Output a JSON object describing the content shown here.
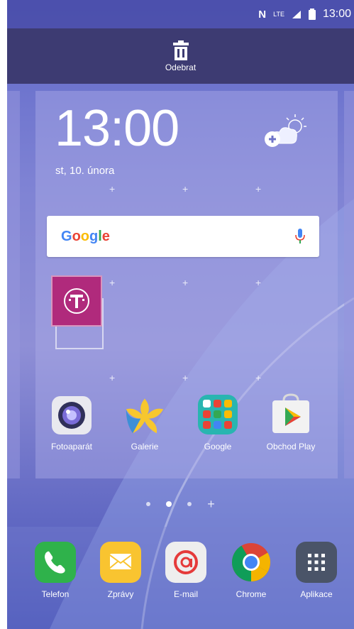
{
  "status_bar": {
    "time": "13:00",
    "network": "LTE",
    "nfc": "N"
  },
  "top_action": {
    "label": "Odebrat"
  },
  "widget": {
    "time": "13:00",
    "date": "st, 10. února"
  },
  "search": {
    "logo_letters": [
      "G",
      "o",
      "o",
      "g",
      "l",
      "e"
    ]
  },
  "home_apps": [
    {
      "label": "Fotoaparát"
    },
    {
      "label": "Galerie"
    },
    {
      "label": "Google"
    },
    {
      "label": "Obchod Play"
    }
  ],
  "dock_apps": [
    {
      "label": "Telefon"
    },
    {
      "label": "Zprávy"
    },
    {
      "label": "E-mail"
    },
    {
      "label": "Chrome"
    },
    {
      "label": "Aplikace"
    }
  ],
  "page_indicator": {
    "count": 3,
    "active_index": 1
  },
  "colors": {
    "topbar": "#3d3b72",
    "tmobile": "#b02a7c"
  }
}
